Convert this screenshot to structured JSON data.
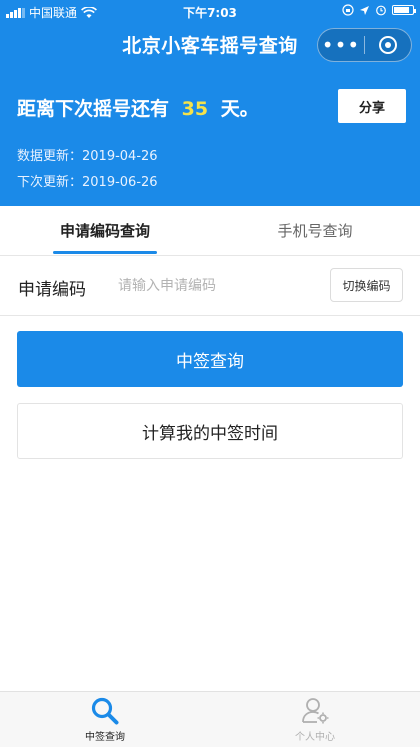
{
  "status_bar": {
    "carrier": "中国联通",
    "time": "下午7:03"
  },
  "nav": {
    "title": "北京小客车摇号查询",
    "more_glyph": "•••"
  },
  "header": {
    "countdown_prefix": "距离下次摇号还有",
    "countdown_days": "35",
    "countdown_suffix": "天。",
    "share_label": "分享",
    "data_update": "数据更新：2019-04-26",
    "next_update": "下次更新：2019-06-26"
  },
  "tabs": [
    {
      "label": "申请编码查询",
      "active": true
    },
    {
      "label": "手机号查询",
      "active": false
    }
  ],
  "form": {
    "label": "申请编码",
    "value": "",
    "placeholder": "请输入申请编码",
    "switch_label": "切换编码"
  },
  "actions": {
    "query_label": "中签查询",
    "calc_label": "计算我的中签时间"
  },
  "bottom_nav": [
    {
      "label": "中签查询",
      "icon": "search-icon",
      "active": true
    },
    {
      "label": "个人中心",
      "icon": "user-settings-icon",
      "active": false
    }
  ],
  "colors": {
    "primary": "#1b8ae8",
    "highlight": "#f5e24a"
  },
  "battery_level": 0.85
}
